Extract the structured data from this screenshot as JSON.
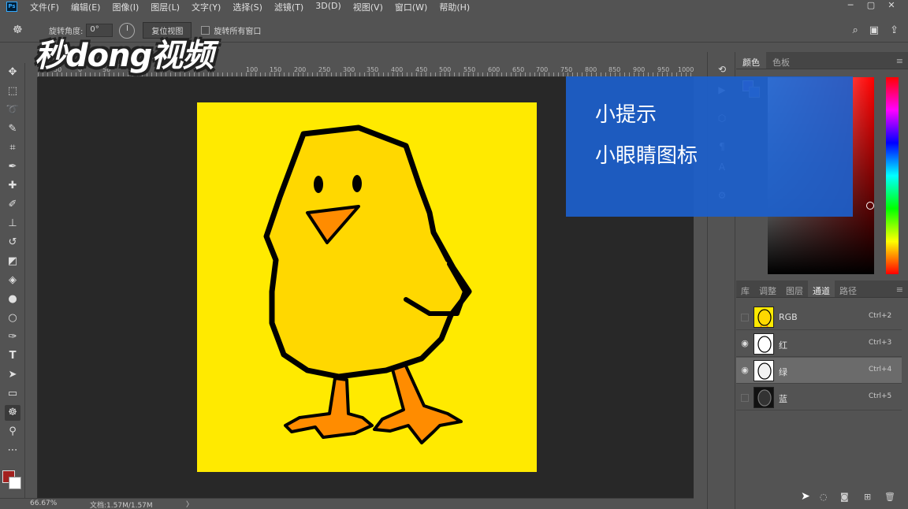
{
  "app": {
    "logo": "Ps"
  },
  "menubar": {
    "items": [
      "文件(F)",
      "编辑(E)",
      "图像(I)",
      "图层(L)",
      "文字(Y)",
      "选择(S)",
      "滤镜(T)",
      "3D(D)",
      "视图(V)",
      "窗口(W)",
      "帮助(H)"
    ],
    "window_controls": [
      "─",
      "▢",
      "✕"
    ]
  },
  "options": {
    "rotate_angle_label": "旋转角度:",
    "rotate_angle_value": "0°",
    "reset_view_label": "复位视图",
    "rotate_all_windows_label": "旋转所有窗口"
  },
  "watermark": {
    "text": "秒dong视频"
  },
  "ruler": {
    "labels": [
      "50",
      "0",
      "50",
      "100",
      "150",
      "200",
      "250",
      "300",
      "350",
      "400",
      "450",
      "500",
      "550",
      "600",
      "650",
      "700",
      "750",
      "800",
      "850",
      "900",
      "950",
      "1000"
    ]
  },
  "status": {
    "zoom": "66.67%",
    "doc_info": "文档:1.57M/1.57M",
    "arrow": "〉"
  },
  "color_panel": {
    "tabs": [
      "颜色",
      "色板"
    ],
    "active_tab": "颜色",
    "foreground": "#7b5bd6",
    "background": "#6a84d8"
  },
  "channels_panel": {
    "tabs": [
      "库",
      "调整",
      "图层",
      "通道",
      "路径"
    ],
    "active_tab": "通道",
    "channels": [
      {
        "name": "RGB",
        "shortcut": "Ctrl+2",
        "visible": false,
        "selected": false
      },
      {
        "name": "红",
        "shortcut": "Ctrl+3",
        "visible": true,
        "selected": false
      },
      {
        "name": "绿",
        "shortcut": "Ctrl+4",
        "visible": true,
        "selected": true
      },
      {
        "name": "蓝",
        "shortcut": "Ctrl+5",
        "visible": false,
        "selected": false
      }
    ]
  },
  "tip": {
    "title": "小提示",
    "text": "小眼睛图标"
  },
  "colors": {
    "canvas_yellow": "#ffea00",
    "chick_body": "#ffd800",
    "beak": "#ff8c00",
    "tip_blue": "#1c60cc"
  }
}
